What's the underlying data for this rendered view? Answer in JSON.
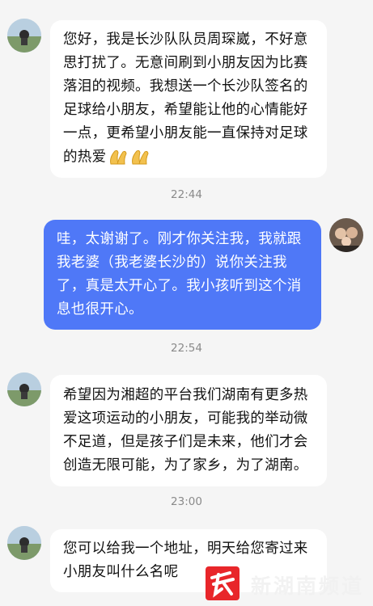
{
  "messages": [
    {
      "lines": [
        "您好，我是长沙队队员周琛崴，不好意",
        "思打扰了。无意间刷到小朋友因为比赛",
        "落泪的视频。我想送一个长沙队签名的",
        "足球给小朋友，希望能让他的心情能好",
        "一点，更希望小朋友能一直保持对足球",
        "的热爱"
      ],
      "emoji": "pray-hands"
    },
    {
      "lines": [
        "哇，太谢谢了。刚才你关注我，我就跟",
        "我老婆（我老婆长沙的）说你关注我",
        "了，真是太开心了。我小孩听到这个消",
        "息也很开心。"
      ]
    },
    {
      "lines": [
        "希望因为湘超的平台我们湖南有更多热",
        "爱这项运动的小朋友，可能我的举动微",
        "不足道，但是孩子们是未来，他们才会",
        "创造无限可能，为了家乡，为了湖南。"
      ]
    },
    {
      "lines": [
        "您可以给我一个地址，明天给您寄过来",
        "小朋友叫什么名呢"
      ]
    }
  ],
  "timestamps": [
    "22:44",
    "22:54",
    "23:00"
  ],
  "watermark": {
    "text": "新湖南频道"
  },
  "colors": {
    "sent_bubble": "#4f78f7",
    "received_bubble": "#ffffff",
    "background": "#f5f5f5"
  }
}
